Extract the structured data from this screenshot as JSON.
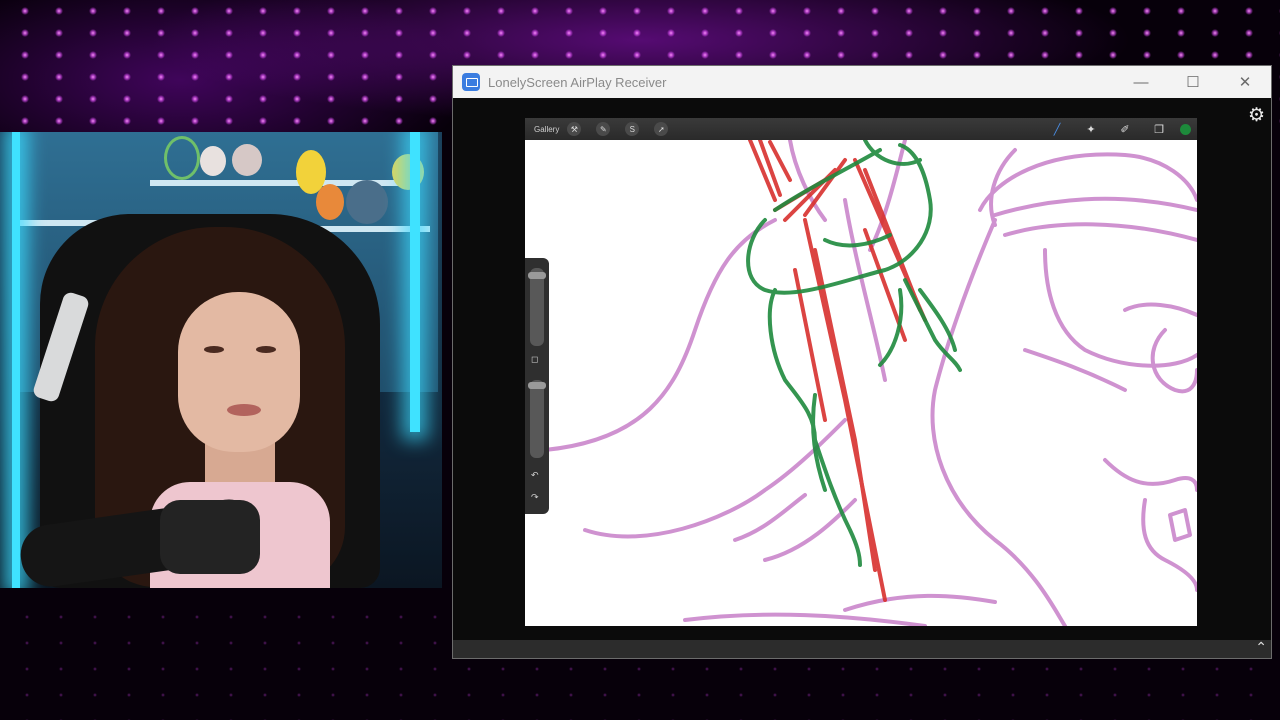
{
  "window": {
    "title": "LonelyScreen AirPlay Receiver",
    "minimize_label": "—",
    "maximize_label": "☐",
    "close_label": "✕"
  },
  "toolbar": {
    "gallery_label": "Gallery",
    "left_icons": [
      "wrench-icon",
      "adjustments-icon",
      "selection-icon",
      "transform-icon"
    ],
    "right_icons": [
      "brush-icon",
      "smudge-icon",
      "eraser-icon",
      "layers-icon"
    ],
    "current_color": "#1d8a3b"
  },
  "sidebar": {
    "undo_label": "↶",
    "redo_label": "↷",
    "modify_label": "◻"
  },
  "colors": {
    "sketch_pink": "#c77fc8",
    "sketch_red": "#d8302e",
    "sketch_green": "#1f8a3e",
    "led_purple": "#e07bff",
    "neon_cyan": "#3fe2ff"
  }
}
